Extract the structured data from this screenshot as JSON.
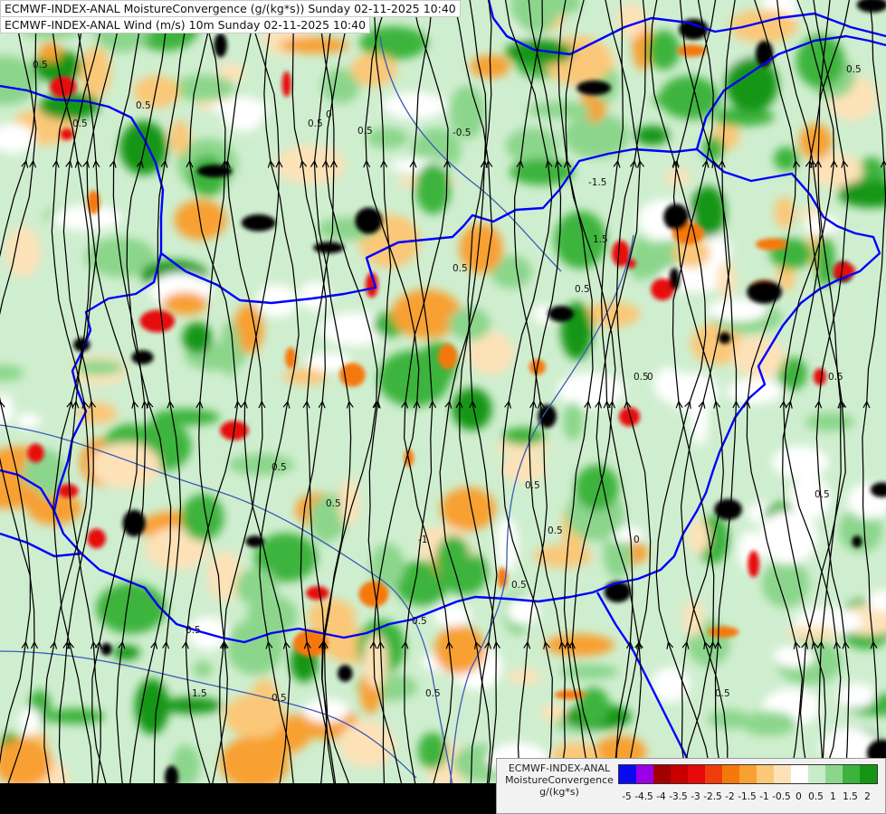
{
  "titles": {
    "line1": "ECMWF-INDEX-ANAL MoistureConvergence (g/(kg*s)) Sunday 02-11-2025 10:40",
    "line2": "ECMWF-INDEX-ANAL Wind (m/s) 10m Sunday 02-11-2025 10:40"
  },
  "legend": {
    "model": "ECMWF-INDEX-ANAL",
    "parameter": "MoistureConvergence",
    "unit": "g/(kg*s)",
    "ticks": [
      "-5",
      "-4.5",
      "-4",
      "-3.5",
      "-3",
      "-2.5",
      "-2",
      "-1.5",
      "-1",
      "-0.5",
      "0",
      "0.5",
      "1",
      "1.5",
      "2"
    ],
    "colors": [
      "#0a0af0",
      "#9a00e6",
      "#a00000",
      "#c80000",
      "#e60a0a",
      "#f03c0a",
      "#f5780a",
      "#f8a030",
      "#fac878",
      "#fde2b8",
      "#ffffff",
      "#c8ecc8",
      "#8cd68c",
      "#3cb43c",
      "#149614"
    ]
  },
  "contour_labels": [
    "0.5",
    "0.5",
    "0.5",
    "0.5",
    "0",
    "0.5",
    "-0.5",
    "-1.5",
    "1.5",
    "0.5",
    "0.5",
    "0",
    "0.5",
    "0.5",
    "-1",
    "0.5",
    "0.5",
    "0.5",
    "0.5",
    "1.5",
    "0.5",
    "0.5",
    "0.5",
    "0",
    "0.5",
    "0.5",
    "0.5",
    "0.5",
    "0.5"
  ],
  "map_colors": {
    "border": "#0000ff",
    "river": "#3c5ab4",
    "streamline": "#000000",
    "strong_convergence": "#000000"
  }
}
